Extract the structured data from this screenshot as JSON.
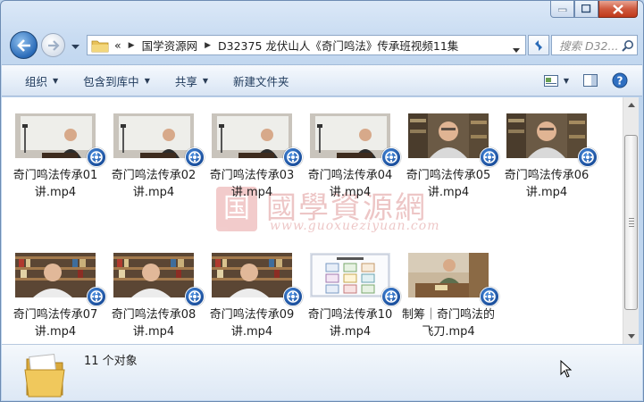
{
  "window": {
    "title": "D32375 龙伏山人《奇门鸣法》传承班视频11集"
  },
  "address_bar": {
    "overflow": "«",
    "crumbs": [
      "国学资源网",
      "D32375 龙伏山人《奇门鸣法》传承班视频11集"
    ]
  },
  "search": {
    "placeholder": "搜索 D32..."
  },
  "toolbar": {
    "organize": "组织",
    "include_in_library": "包含到库中",
    "share": "共享",
    "new_folder": "新建文件夹"
  },
  "files": [
    {
      "line1": "奇门鸣法传承01",
      "line2": "讲.mp4",
      "scene": "whiteboard"
    },
    {
      "line1": "奇门鸣法传承02",
      "line2": "讲.mp4",
      "scene": "whiteboard"
    },
    {
      "line1": "奇门鸣法传承03",
      "line2": "讲.mp4",
      "scene": "whiteboard"
    },
    {
      "line1": "奇门鸣法传承04",
      "line2": "讲.mp4",
      "scene": "whiteboard"
    },
    {
      "line1": "奇门鸣法传承05",
      "line2": "讲.mp4",
      "scene": "portrait"
    },
    {
      "line1": "奇门鸣法传承06",
      "line2": "讲.mp4",
      "scene": "portrait"
    },
    {
      "line1": "奇门鸣法传承07",
      "line2": "讲.mp4",
      "scene": "bookshelf"
    },
    {
      "line1": "奇门鸣法传承08",
      "line2": "讲.mp4",
      "scene": "bookshelf"
    },
    {
      "line1": "奇门鸣法传承09",
      "line2": "讲.mp4",
      "scene": "bookshelf"
    },
    {
      "line1": "奇门鸣法传承10",
      "line2": "讲.mp4",
      "scene": "slide"
    },
    {
      "line1": "制筹｜奇门鸣法的",
      "line2": "飞刀.mp4",
      "scene": "table"
    }
  ],
  "watermark": {
    "seal": "国",
    "title": "國學資源網",
    "url": "www.guoxueziyuan.com"
  },
  "details": {
    "count_text": "11 个对象"
  },
  "colors": {
    "accent": "#2a6bb8",
    "badge": "#1b4f9c"
  }
}
